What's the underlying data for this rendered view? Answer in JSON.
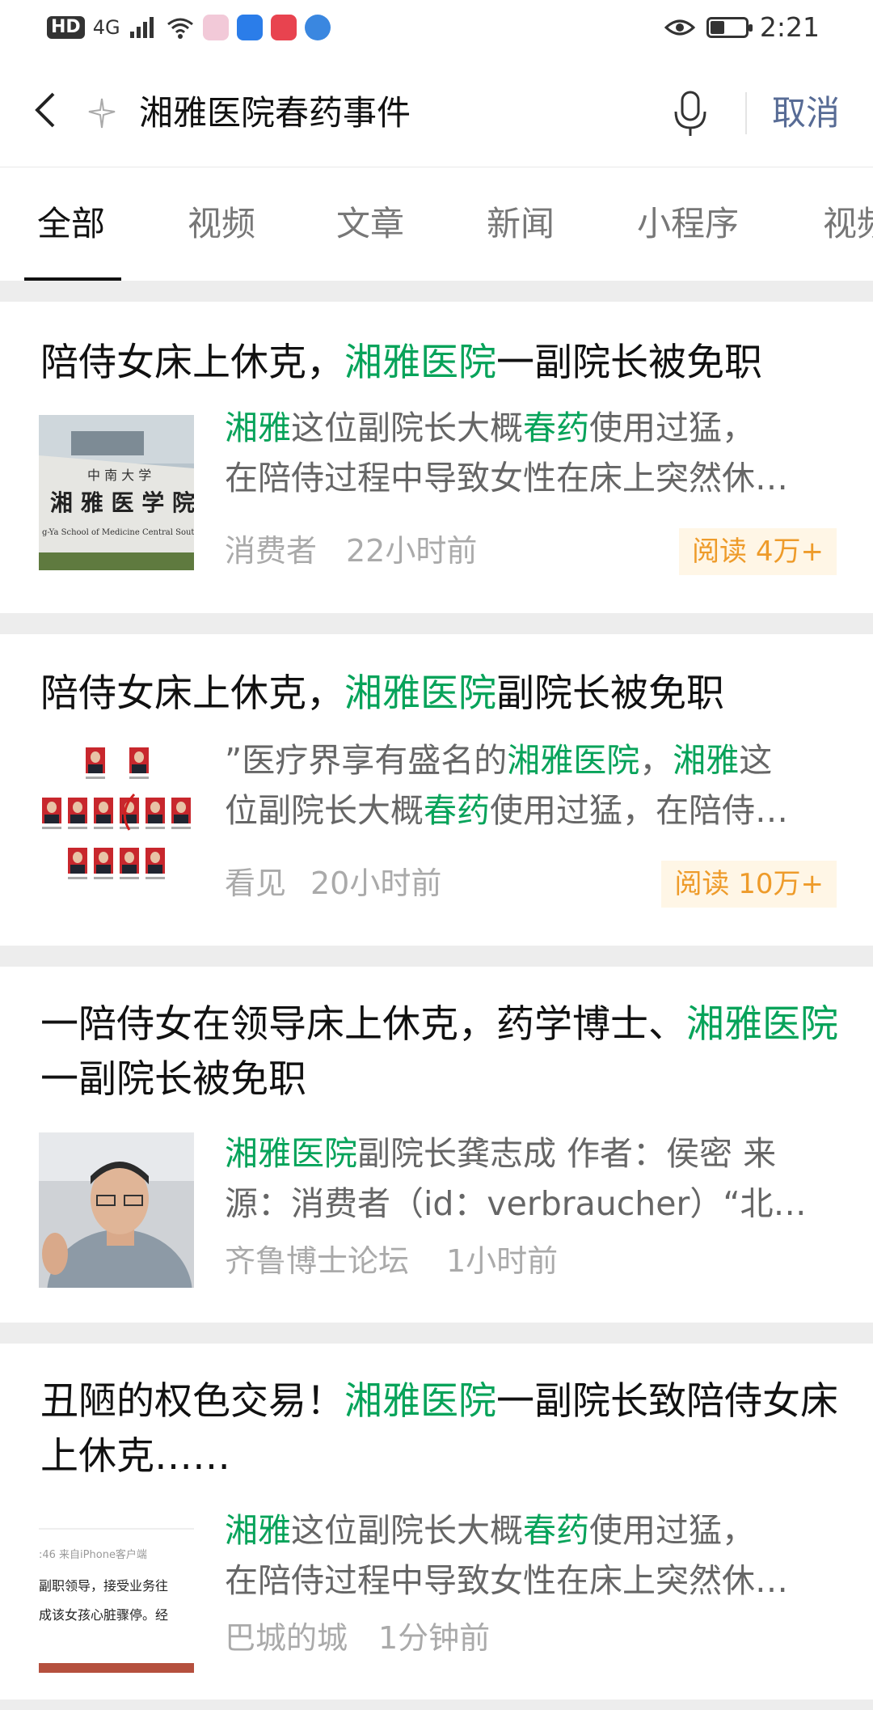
{
  "status_bar": {
    "hd": "HD",
    "network": "4G",
    "time": "2:21",
    "battery_level": 0.4
  },
  "search": {
    "query": "湘雅医院春药事件",
    "cancel_label": "取消"
  },
  "tabs": [
    "全部",
    "视频",
    "文章",
    "新闻",
    "小程序",
    "视频"
  ],
  "results": [
    {
      "title_parts": [
        {
          "text": "陪侍女床上休克，",
          "hl": false
        },
        {
          "text": "湘雅医院",
          "hl": true
        },
        {
          "text": "一副院长被免职",
          "hl": false
        }
      ],
      "snippet_line1": [
        {
          "text": "湘雅",
          "hl": true
        },
        {
          "text": "这位副院长大概",
          "hl": false
        },
        {
          "text": "春药",
          "hl": true
        },
        {
          "text": "使用过猛，",
          "hl": false
        }
      ],
      "snippet_line2": "在陪侍过程中导致女性在床上突然休…",
      "source": "消费者",
      "time": "22小时前",
      "reads": "阅读 4万+",
      "thumb": {
        "kind": "school-sign",
        "sign_top": "中 南 大 学",
        "sign_main": "湘 雅 医 学 院",
        "sign_en": "g-Ya School of Medicine Central South University"
      }
    },
    {
      "title_parts": [
        {
          "text": "陪侍女床上休克，",
          "hl": false
        },
        {
          "text": "湘雅医院",
          "hl": true
        },
        {
          "text": "副院长被免职",
          "hl": false
        }
      ],
      "snippet_line1": [
        {
          "text": "”医疗界享有盛名的",
          "hl": false
        },
        {
          "text": "湘雅医院",
          "hl": true
        },
        {
          "text": "，",
          "hl": false
        },
        {
          "text": "湘雅",
          "hl": true
        },
        {
          "text": "这",
          "hl": false
        }
      ],
      "snippet_line2_parts": [
        {
          "text": "位副院长大概",
          "hl": false
        },
        {
          "text": "春药",
          "hl": true
        },
        {
          "text": "使用过猛，在陪侍…",
          "hl": false
        }
      ],
      "source": "看见",
      "time": "20小时前",
      "reads": "阅读 10万+",
      "thumb": {
        "kind": "portrait-grid"
      }
    },
    {
      "title_parts": [
        {
          "text": "一陪侍女在领导床上休克，药学博士、",
          "hl": false
        },
        {
          "text": "湘雅医院",
          "hl": true
        },
        {
          "text": "一副院长被免职",
          "hl": false
        }
      ],
      "snippet_line1": [
        {
          "text": "湘雅医院",
          "hl": true
        },
        {
          "text": "副院长龚志成 作者：侯密 来",
          "hl": false
        }
      ],
      "snippet_line2": "源：消费者（id：verbraucher）“北…",
      "source": "齐鲁博士论坛",
      "time": "1小时前",
      "thumb": {
        "kind": "man-photo"
      }
    },
    {
      "title_parts": [
        {
          "text": "丑陋的权色交易！",
          "hl": false
        },
        {
          "text": "湘雅医院",
          "hl": true
        },
        {
          "text": "一副院长致陪侍女床上休克……",
          "hl": false
        }
      ],
      "snippet_line1": [
        {
          "text": "湘雅",
          "hl": true
        },
        {
          "text": "这位副院长大概",
          "hl": false
        },
        {
          "text": "春药",
          "hl": true
        },
        {
          "text": "使用过猛，",
          "hl": false
        }
      ],
      "snippet_line2": "在陪侍过程中导致女性在床上突然休…",
      "source": "巴城的城",
      "time": "1分钟前",
      "thumb": {
        "kind": "text-screenshot",
        "lines": [
          ":46 来自iPhone客户端",
          "副职领导，接受业务往",
          "成该女孩心脏骤停。经"
        ]
      }
    }
  ],
  "colors": {
    "highlight": "#07a35a",
    "cancel": "#576b95",
    "badge_bg": "#fff6e6",
    "badge_text": "#ee9b2a"
  }
}
